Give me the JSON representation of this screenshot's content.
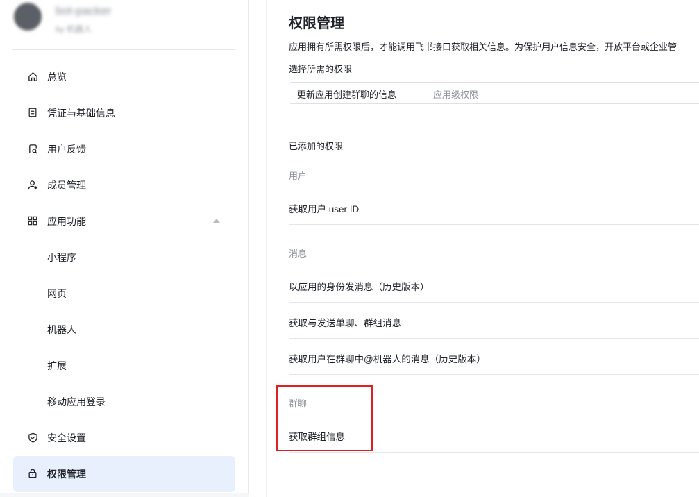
{
  "sidebar": {
    "app_name": "bot-packer",
    "app_sub": "by 机器人",
    "items": [
      {
        "label": "总览",
        "icon": "home-icon"
      },
      {
        "label": "凭证与基础信息",
        "icon": "id-card-icon"
      },
      {
        "label": "用户反馈",
        "icon": "feedback-icon"
      },
      {
        "label": "成员管理",
        "icon": "user-add-icon"
      },
      {
        "label": "应用功能",
        "icon": "grid-icon"
      },
      {
        "label": "小程序"
      },
      {
        "label": "网页"
      },
      {
        "label": "机器人"
      },
      {
        "label": "扩展"
      },
      {
        "label": "移动应用登录"
      },
      {
        "label": "安全设置",
        "icon": "shield-icon"
      },
      {
        "label": "权限管理",
        "icon": "lock-icon"
      }
    ],
    "active_item": "权限管理"
  },
  "main": {
    "title": "权限管理",
    "description": "应用拥有所需权限后，才能调用飞书接口获取相关信息。为保护用户信息安全，开放平台或企业管",
    "select_label": "选择所需的权限",
    "select": {
      "value": "更新应用创建群聊的信息",
      "hint": "应用级权限"
    },
    "added_label": "已添加的权限",
    "groups": [
      {
        "name": "用户",
        "permissions": [
          "获取用户 user ID"
        ]
      },
      {
        "name": "消息",
        "permissions": [
          "以应用的身份发消息（历史版本）",
          "获取与发送单聊、群组消息",
          "获取用户在群聊中@机器人的消息（历史版本）"
        ]
      },
      {
        "name": "群聊",
        "permissions": [
          "获取群组信息"
        ]
      }
    ]
  },
  "colors": {
    "active_bg": "#e8f0fe",
    "highlight_border": "#e02020",
    "muted_text": "#8f959e"
  }
}
